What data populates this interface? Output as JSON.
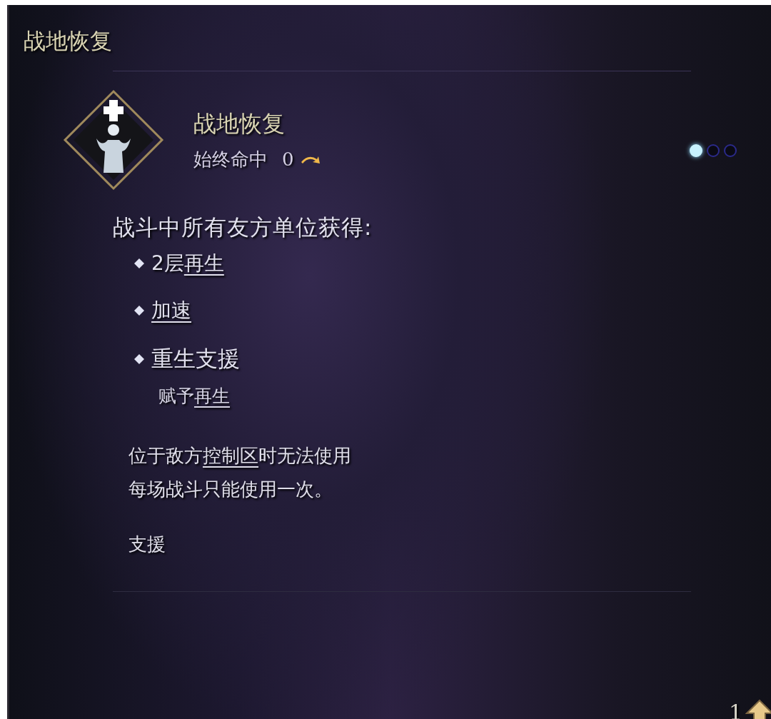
{
  "panel": {
    "title": "战地恢复"
  },
  "skill": {
    "name": "战地恢复",
    "accuracy": "始终命中",
    "cost": "0"
  },
  "pips": [
    {
      "selected": true
    },
    {
      "selected": false
    },
    {
      "selected": false
    }
  ],
  "description": {
    "heading": "战斗中所有友方单位获得:",
    "effects": [
      {
        "segments": [
          {
            "text": "2层",
            "keyword": false
          },
          {
            "text": "再生",
            "keyword": true
          }
        ]
      },
      {
        "segments": [
          {
            "text": "加速",
            "keyword": true
          }
        ]
      },
      {
        "segments": [
          {
            "text": "重生支援",
            "keyword": false
          }
        ],
        "detail": [
          {
            "text": "赋予",
            "keyword": false
          },
          {
            "text": "再生",
            "keyword": true
          }
        ]
      }
    ],
    "notes": [
      {
        "segments": [
          {
            "text": "位于敌方",
            "keyword": false
          },
          {
            "text": "控制区",
            "keyword": true
          },
          {
            "text": "时无法使用",
            "keyword": false
          }
        ]
      },
      {
        "segments": [
          {
            "text": "每场战斗只能使用一次。",
            "keyword": false
          }
        ]
      }
    ],
    "tag": "支援"
  },
  "footer": {
    "count": "1"
  }
}
